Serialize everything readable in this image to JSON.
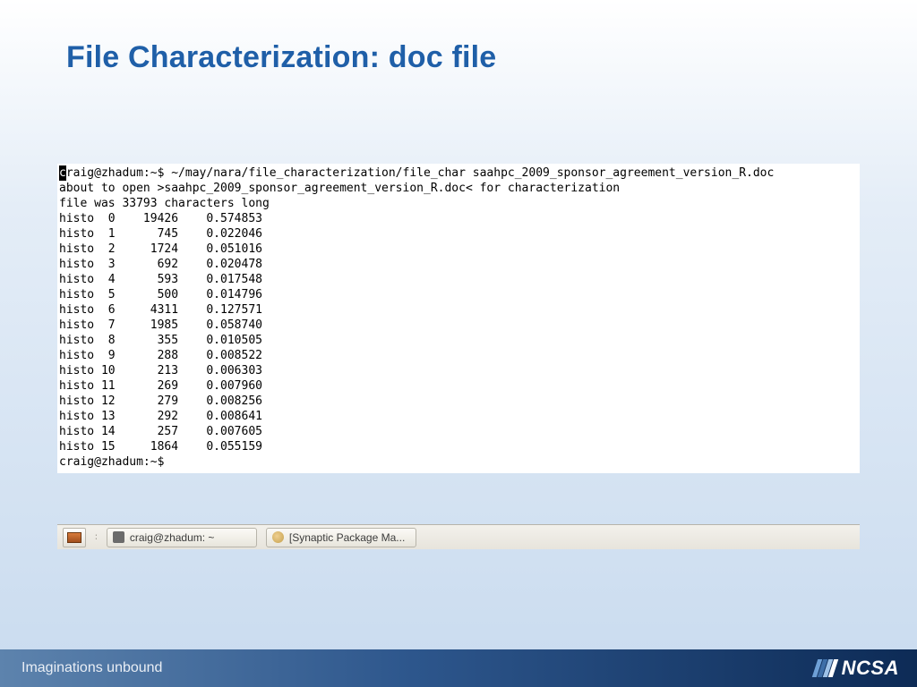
{
  "title": "File Characterization: doc file",
  "terminal": {
    "prompt_first_char": "c",
    "prompt_rest": "raig@zhadum:~$ ",
    "command": "~/may/nara/file_characterization/file_char saahpc_2009_sponsor_agreement_version_R.doc",
    "msg_open": "about to open >saahpc_2009_sponsor_agreement_version_R.doc< for characterization",
    "msg_len": "file was 33793 characters long",
    "prompt2": "craig@zhadum:~$ ",
    "histo": [
      {
        "i": 0,
        "count": 19426,
        "frac": "0.574853"
      },
      {
        "i": 1,
        "count": 745,
        "frac": "0.022046"
      },
      {
        "i": 2,
        "count": 1724,
        "frac": "0.051016"
      },
      {
        "i": 3,
        "count": 692,
        "frac": "0.020478"
      },
      {
        "i": 4,
        "count": 593,
        "frac": "0.017548"
      },
      {
        "i": 5,
        "count": 500,
        "frac": "0.014796"
      },
      {
        "i": 6,
        "count": 4311,
        "frac": "0.127571"
      },
      {
        "i": 7,
        "count": 1985,
        "frac": "0.058740"
      },
      {
        "i": 8,
        "count": 355,
        "frac": "0.010505"
      },
      {
        "i": 9,
        "count": 288,
        "frac": "0.008522"
      },
      {
        "i": 10,
        "count": 213,
        "frac": "0.006303"
      },
      {
        "i": 11,
        "count": 269,
        "frac": "0.007960"
      },
      {
        "i": 12,
        "count": 279,
        "frac": "0.008256"
      },
      {
        "i": 13,
        "count": 292,
        "frac": "0.008641"
      },
      {
        "i": 14,
        "count": 257,
        "frac": "0.007605"
      },
      {
        "i": 15,
        "count": 1864,
        "frac": "0.055159"
      }
    ]
  },
  "taskbar": {
    "sep": "∶",
    "item1": "craig@zhadum: ~",
    "item2": "[Synaptic Package Ma..."
  },
  "footer": {
    "tagline": "Imaginations unbound",
    "logo_text": "NCSA"
  }
}
